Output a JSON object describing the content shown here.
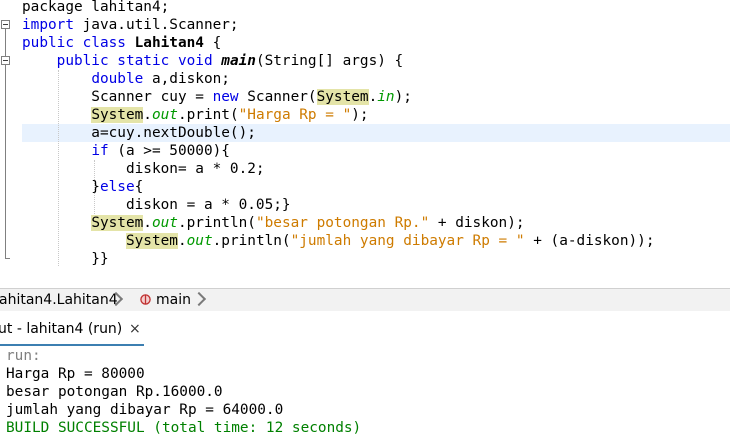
{
  "editor": {
    "lines": [
      {
        "parts": [
          {
            "t": "package lahitan4;",
            "c": ""
          }
        ]
      },
      {
        "parts": [
          {
            "t": "import",
            "c": "kw"
          },
          {
            "t": " java.util.Scanner;",
            "c": ""
          }
        ]
      },
      {
        "parts": [
          {
            "t": "public class ",
            "c": "kw"
          },
          {
            "t": "Lahitan4",
            "c": "bold"
          },
          {
            "t": " {",
            "c": ""
          }
        ]
      },
      {
        "parts": [
          {
            "t": "    public static void ",
            "c": "kw"
          },
          {
            "t": "main",
            "c": "m"
          },
          {
            "t": "(String[] args) {",
            "c": ""
          }
        ]
      },
      {
        "parts": [
          {
            "t": "        ",
            "c": ""
          },
          {
            "t": "double",
            "c": "kw"
          },
          {
            "t": " a,diskon;",
            "c": ""
          }
        ]
      },
      {
        "parts": [
          {
            "t": "        Scanner cuy = ",
            "c": ""
          },
          {
            "t": "new",
            "c": "kw"
          },
          {
            "t": " Scanner(",
            "c": ""
          },
          {
            "t": "System",
            "c": "sys"
          },
          {
            "t": ".",
            "c": ""
          },
          {
            "t": "in",
            "c": "fld"
          },
          {
            "t": ");",
            "c": ""
          }
        ]
      },
      {
        "parts": [
          {
            "t": "        ",
            "c": ""
          },
          {
            "t": "System",
            "c": "sys"
          },
          {
            "t": ".",
            "c": ""
          },
          {
            "t": "out",
            "c": "fld"
          },
          {
            "t": ".print(",
            "c": ""
          },
          {
            "t": "\"Harga Rp = \"",
            "c": "str"
          },
          {
            "t": ");",
            "c": ""
          }
        ]
      },
      {
        "parts": [
          {
            "t": "        a=cuy.nextDouble();",
            "c": ""
          }
        ]
      },
      {
        "parts": [
          {
            "t": "        ",
            "c": ""
          },
          {
            "t": "if",
            "c": "kw"
          },
          {
            "t": " (a >= 50000){",
            "c": ""
          }
        ]
      },
      {
        "parts": [
          {
            "t": "            diskon= a * 0.2;",
            "c": ""
          }
        ]
      },
      {
        "parts": [
          {
            "t": "        }",
            "c": ""
          },
          {
            "t": "else",
            "c": "kw"
          },
          {
            "t": "{",
            "c": ""
          }
        ]
      },
      {
        "parts": [
          {
            "t": "            diskon = a * 0.05;}",
            "c": ""
          }
        ]
      },
      {
        "parts": [
          {
            "t": "        ",
            "c": ""
          },
          {
            "t": "System",
            "c": "sys"
          },
          {
            "t": ".",
            "c": ""
          },
          {
            "t": "out",
            "c": "fld"
          },
          {
            "t": ".println(",
            "c": ""
          },
          {
            "t": "\"besar potongan Rp.\"",
            "c": "str"
          },
          {
            "t": " + diskon);",
            "c": ""
          }
        ]
      },
      {
        "parts": [
          {
            "t": "            ",
            "c": ""
          },
          {
            "t": "System",
            "c": "sys"
          },
          {
            "t": ".",
            "c": ""
          },
          {
            "t": "out",
            "c": "fld"
          },
          {
            "t": ".println(",
            "c": ""
          },
          {
            "t": "\"jumlah yang dibayar Rp = \"",
            "c": "str"
          },
          {
            "t": " + (a-diskon));",
            "c": ""
          }
        ]
      },
      {
        "parts": [
          {
            "t": "        }}",
            "c": ""
          }
        ]
      }
    ]
  },
  "breadcrumb": {
    "class_item": "ahitan4.Lahitan4",
    "method_item": "main",
    "method_icon": "method-icon"
  },
  "output_tab": {
    "label": "ut - lahitan4 (run)",
    "close": "×"
  },
  "output": {
    "lines": [
      {
        "text": "run:",
        "color": "#808080"
      },
      {
        "text": "Harga Rp = 80000",
        "color": "#000000"
      },
      {
        "text": "besar potongan Rp.16000.0",
        "color": "#000000"
      },
      {
        "text": "jumlah yang dibayar Rp = 64000.0",
        "color": "#000000"
      },
      {
        "text": "BUILD SUCCESSFUL (total time: 12 seconds)",
        "color": "#008000"
      }
    ]
  }
}
